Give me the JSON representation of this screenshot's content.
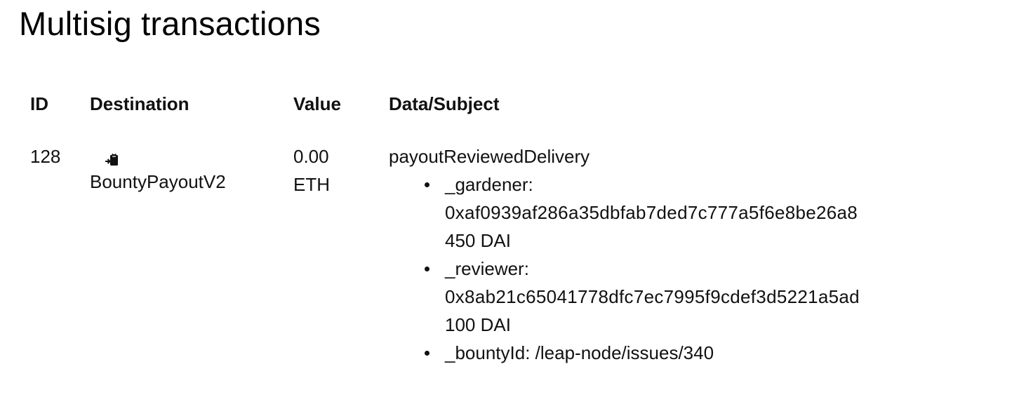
{
  "page": {
    "title": "Multisig transactions"
  },
  "table": {
    "headers": {
      "id": "ID",
      "destination": "Destination",
      "value": "Value",
      "data": "Data/Subject"
    },
    "rows": [
      {
        "id": "128",
        "destination": {
          "icon": "clipboard-paste-icon",
          "name": "BountyPayoutV2"
        },
        "value": {
          "amount": "0.00",
          "unit": "ETH"
        },
        "data": {
          "method": "payoutReviewedDelivery",
          "params": [
            {
              "label": "_gardener:",
              "address": "0xaf0939af286a35dbfab7ded7c777a5f6e8be26a8",
              "amount": "450 DAI"
            },
            {
              "label": "_reviewer:",
              "address": "0x8ab21c65041778dfc7ec7995f9cdef3d5221a5ad",
              "amount": "100 DAI"
            },
            {
              "label": "_bountyId: /leap-node/issues/340"
            }
          ]
        }
      }
    ]
  }
}
